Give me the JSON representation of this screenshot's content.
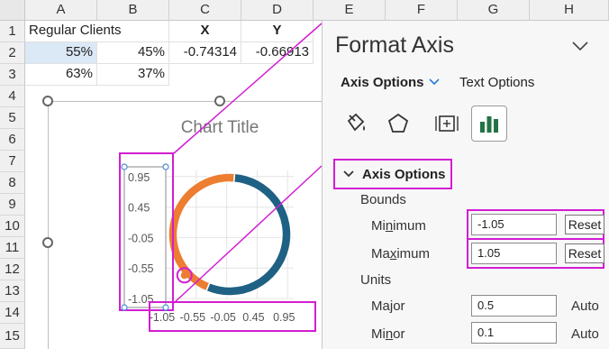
{
  "sheet": {
    "columns": [
      "A",
      "B",
      "C",
      "D",
      "E",
      "F",
      "G",
      "H"
    ],
    "rows": [
      "1",
      "2",
      "3",
      "4",
      "5",
      "6",
      "7",
      "8",
      "9",
      "10",
      "11",
      "12",
      "13",
      "14",
      "15"
    ],
    "cells": {
      "a1": "Regular Clients",
      "c1": "X",
      "d1": "Y",
      "a2": "55%",
      "b2": "45%",
      "c2": "-0.74314",
      "d2": "-0.66913",
      "a3": "63%",
      "b3": "37%"
    }
  },
  "chart": {
    "title": "Chart Title",
    "y_ticks": [
      "0.95",
      "0.45",
      "-0.05",
      "-0.55",
      "-1.05"
    ],
    "x_ticks": [
      "-1.05",
      "-0.55",
      "-0.05",
      "0.45",
      "0.95"
    ],
    "colors": {
      "orange": "#ED7D31",
      "blue": "#1F6184",
      "highlight": "#D21ED2"
    }
  },
  "chart_data": {
    "type": "pie",
    "subtype": "doughnut with scatter axes",
    "title": "Chart Title",
    "slices": [
      {
        "label": "Regular Clients",
        "value": 0.55,
        "color": "#1F6184"
      },
      {
        "label": "",
        "value": 0.45,
        "color": "#ED7D31"
      }
    ],
    "scatter_point": {
      "x": -0.74314,
      "y": -0.66913
    },
    "xlim": [
      -1.05,
      1.05
    ],
    "ylim": [
      -1.05,
      1.05
    ],
    "x_ticks": [
      -1.05,
      -0.55,
      -0.05,
      0.45,
      0.95
    ],
    "y_ticks": [
      0.95,
      0.45,
      -0.05,
      -0.55,
      -1.05
    ],
    "grid": true
  },
  "pane": {
    "title": "Format Axis",
    "tab_axis": "Axis Options",
    "tab_text": "Text Options",
    "icons": [
      "fill-line-icon",
      "effects-icon",
      "size-properties-icon",
      "axis-options-icon"
    ],
    "section": "Axis Options",
    "bounds_label": "Bounds",
    "minimum_label_pre": "Mi",
    "minimum_label_u": "n",
    "minimum_label_post": "imum",
    "minimum_value": "-1.05",
    "maximum_label_pre": "Ma",
    "maximum_label_u": "x",
    "maximum_label_post": "imum",
    "maximum_value": "1.05",
    "reset_label": "Reset",
    "units_label": "Units",
    "major_label_pre": "Ma",
    "major_label_u": "j",
    "major_label_post": "or",
    "major_value": "0.5",
    "minor_label_pre": "Mi",
    "minor_label_u": "n",
    "minor_label_post": "or",
    "minor_value": "0.1",
    "auto_label": "Auto"
  }
}
